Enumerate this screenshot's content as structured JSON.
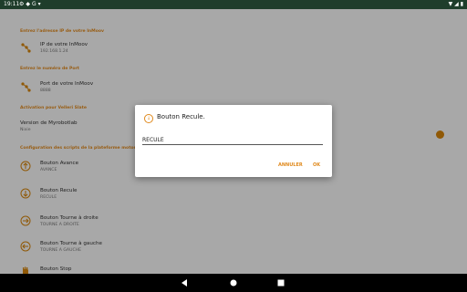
{
  "status_bar": {
    "time": "19:11",
    "notification_icons": [
      "gear-icon",
      "shield-icon",
      "google-icon",
      "download-icon"
    ],
    "right_icons": [
      "wifi-icon",
      "signal-icon",
      "battery-icon"
    ]
  },
  "settings": {
    "sections": [
      {
        "header": "Entrez l'adresse IP de votre InMoov",
        "item": {
          "title": "IP de votre InMoov",
          "summary": "192.168.1.24",
          "icon": "network-icon"
        }
      },
      {
        "header": "Entrez le numéro de Port",
        "item": {
          "title": "Port de votre InMoov",
          "summary": "8888",
          "icon": "network-icon"
        }
      },
      {
        "header": "Activation pour Velleri Slate",
        "item": {
          "title": "Version de Myrobotlab",
          "summary": "Nixie",
          "icon": ""
        }
      },
      {
        "header": "Configuration des scripts de la plateforme motorisée",
        "items": [
          {
            "title": "Bouton Avance",
            "summary": "AVANCE",
            "icon": "arrow-up-circle-icon"
          },
          {
            "title": "Bouton Recule",
            "summary": "RECULE",
            "icon": "arrow-down-circle-icon"
          },
          {
            "title": "Bouton Tourne à droite",
            "summary": "TOURNE A DROITE",
            "icon": "arrow-right-circle-icon"
          },
          {
            "title": "Bouton Tourne à gauche",
            "summary": "TOURNE A GAUCHE",
            "icon": "arrow-left-circle-icon"
          },
          {
            "title": "Bouton Stop",
            "summary": "",
            "icon": "hand-stop-icon"
          }
        ]
      }
    ]
  },
  "dialog": {
    "title": "Bouton Recule.",
    "input_value": "RECULE",
    "cancel_label": "ANNULER",
    "ok_label": "OK"
  },
  "colors": {
    "accent": "#e08a1e",
    "status_bar": "#1f3d2b"
  },
  "nav_bar": {
    "buttons": [
      "back-icon",
      "home-icon",
      "recents-icon"
    ]
  }
}
